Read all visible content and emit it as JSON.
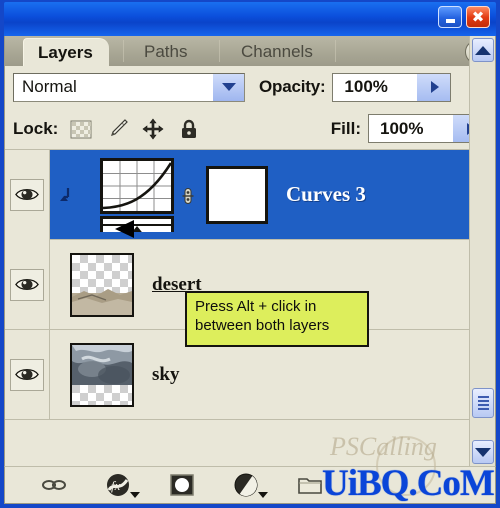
{
  "window": {
    "titlebar_color": "#0b4fdc",
    "minimize_label": "Minimize",
    "close_label": "Close"
  },
  "tabs": [
    {
      "label": "Layers",
      "active": true
    },
    {
      "label": "Paths",
      "active": false
    },
    {
      "label": "Channels",
      "active": false
    }
  ],
  "panel_menu": {
    "label": "Panel menu"
  },
  "blend": {
    "mode_value": "Normal",
    "opacity_label": "Opacity:",
    "opacity_value": "100%"
  },
  "lock": {
    "label": "Lock:",
    "icons": [
      "lock-transparency-icon",
      "lock-image-pixels-icon",
      "lock-position-icon",
      "lock-all-icon"
    ],
    "fill_label": "Fill:",
    "fill_value": "100%"
  },
  "layers": [
    {
      "name": "Curves 3",
      "visible": true,
      "selected": true,
      "type": "adjustment",
      "has_mask": true,
      "has_clip_indicator": true
    },
    {
      "name": "desert",
      "visible": true,
      "selected": false,
      "type": "pixel",
      "has_mask": false,
      "has_clip_indicator": false
    },
    {
      "name": "sky",
      "visible": true,
      "selected": false,
      "type": "pixel",
      "has_mask": false,
      "has_clip_indicator": false
    }
  ],
  "tooltip": {
    "text": "Press Alt + click in between both layers",
    "background": "#ddee5c",
    "border": "#15140f"
  },
  "scrollbar": {
    "up_label": "Scroll up",
    "down_label": "Scroll down",
    "thumb_label": "Scroll thumb"
  },
  "bottom_toolbar": [
    {
      "name": "link-layers-icon",
      "label": "Link layers"
    },
    {
      "name": "layer-style-fx-icon",
      "label": "Add a layer style"
    },
    {
      "name": "layer-mask-icon",
      "label": "Add layer mask"
    },
    {
      "name": "adjustment-layer-icon",
      "label": "Create new fill or adjustment layer"
    },
    {
      "name": "new-group-folder-icon",
      "label": "Create a new group"
    }
  ],
  "watermark": {
    "primary": "UiBQ.CoM",
    "ghost": "PSCalling",
    "primary_color": "#0a45d8"
  }
}
